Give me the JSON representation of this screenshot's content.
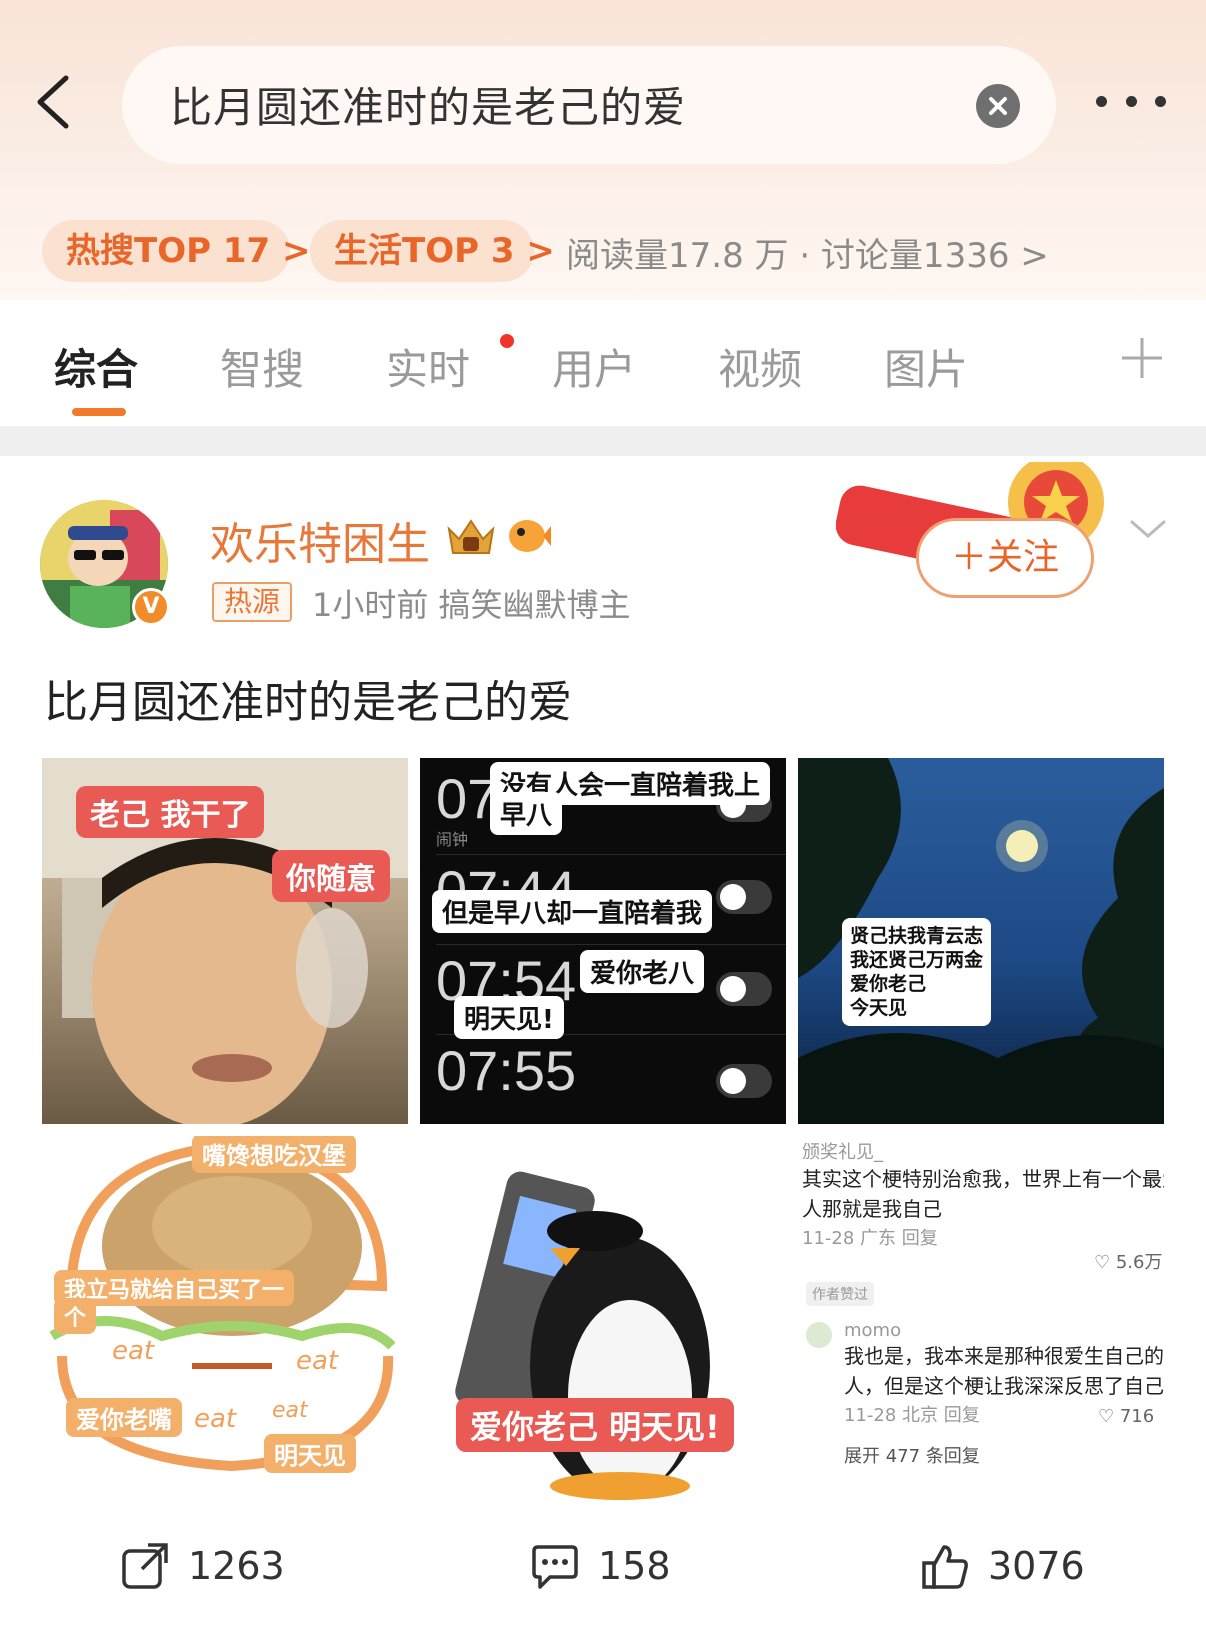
{
  "header": {
    "search_text": "比月圆还准时的是老己的爱",
    "hot_search_tag": "热搜TOP 17 >",
    "life_tag": "生活TOP 3 >",
    "stats": "阅读量17.8 万 · 讨论量1336 >"
  },
  "tabs": {
    "items": [
      "综合",
      "智搜",
      "实时",
      "用户",
      "视频",
      "图片"
    ],
    "active": "综合"
  },
  "post": {
    "username": "欢乐特困生",
    "badge": "热源",
    "meta": "1小时前  搞笑幽默博主",
    "follow_label": "＋关注",
    "text": "比月圆还准时的是老己的爱",
    "images": {
      "img1": {
        "tag_top": "老己 我干了",
        "tag_right": "你随意"
      },
      "img2": {
        "bubble1": "没有人会一直陪着我上",
        "bubble1b": "早八",
        "bubble2": "但是早八却一直陪着我",
        "bubble3": "爱你老八",
        "bubble4": "明天见!",
        "label_alarm": "闹钟",
        "time1": "07",
        "time2": "07:44",
        "time3": "07:54",
        "time4": "07:55"
      },
      "img3": {
        "line1": "贤己扶我青云志",
        "line2": "我还贤己万两金",
        "line3": "爱你老己",
        "line4": "今天见"
      },
      "img4": {
        "tag_top": "嘴馋想吃汉堡",
        "tag_mid": "我立马就给自己买了一",
        "tag_mid2": "个",
        "eat": "eat",
        "tag_love": "爱你老嘴",
        "tag_see": "明天见"
      },
      "img5": {
        "caption": "爱你老己 明天见!"
      },
      "img6": {
        "c1_user": "颁奖礼见_",
        "c1_text1": "其实这个梗特别治愈我，世界上有一个最爱",
        "c1_text2": "人那就是我自己",
        "c1_meta": "11-28 广东   回复",
        "c1_likes": "5.6万",
        "c1_author": "作者赞过",
        "c2_user": "momo",
        "c2_text1": "我也是，我本来是那种很爱生自己的气",
        "c2_text2": "人，但是这个梗让我深深反思了自己",
        "c2_meta": "11-28 北京   回复",
        "c2_likes": "716",
        "expand": "展开 477 条回复"
      }
    },
    "actions": {
      "repost": "1263",
      "comment": "158",
      "like": "3076"
    }
  },
  "colors": {
    "accent": "#e8662a",
    "tag_bg": "#fbe1cf",
    "red_dot": "#f2332a"
  }
}
